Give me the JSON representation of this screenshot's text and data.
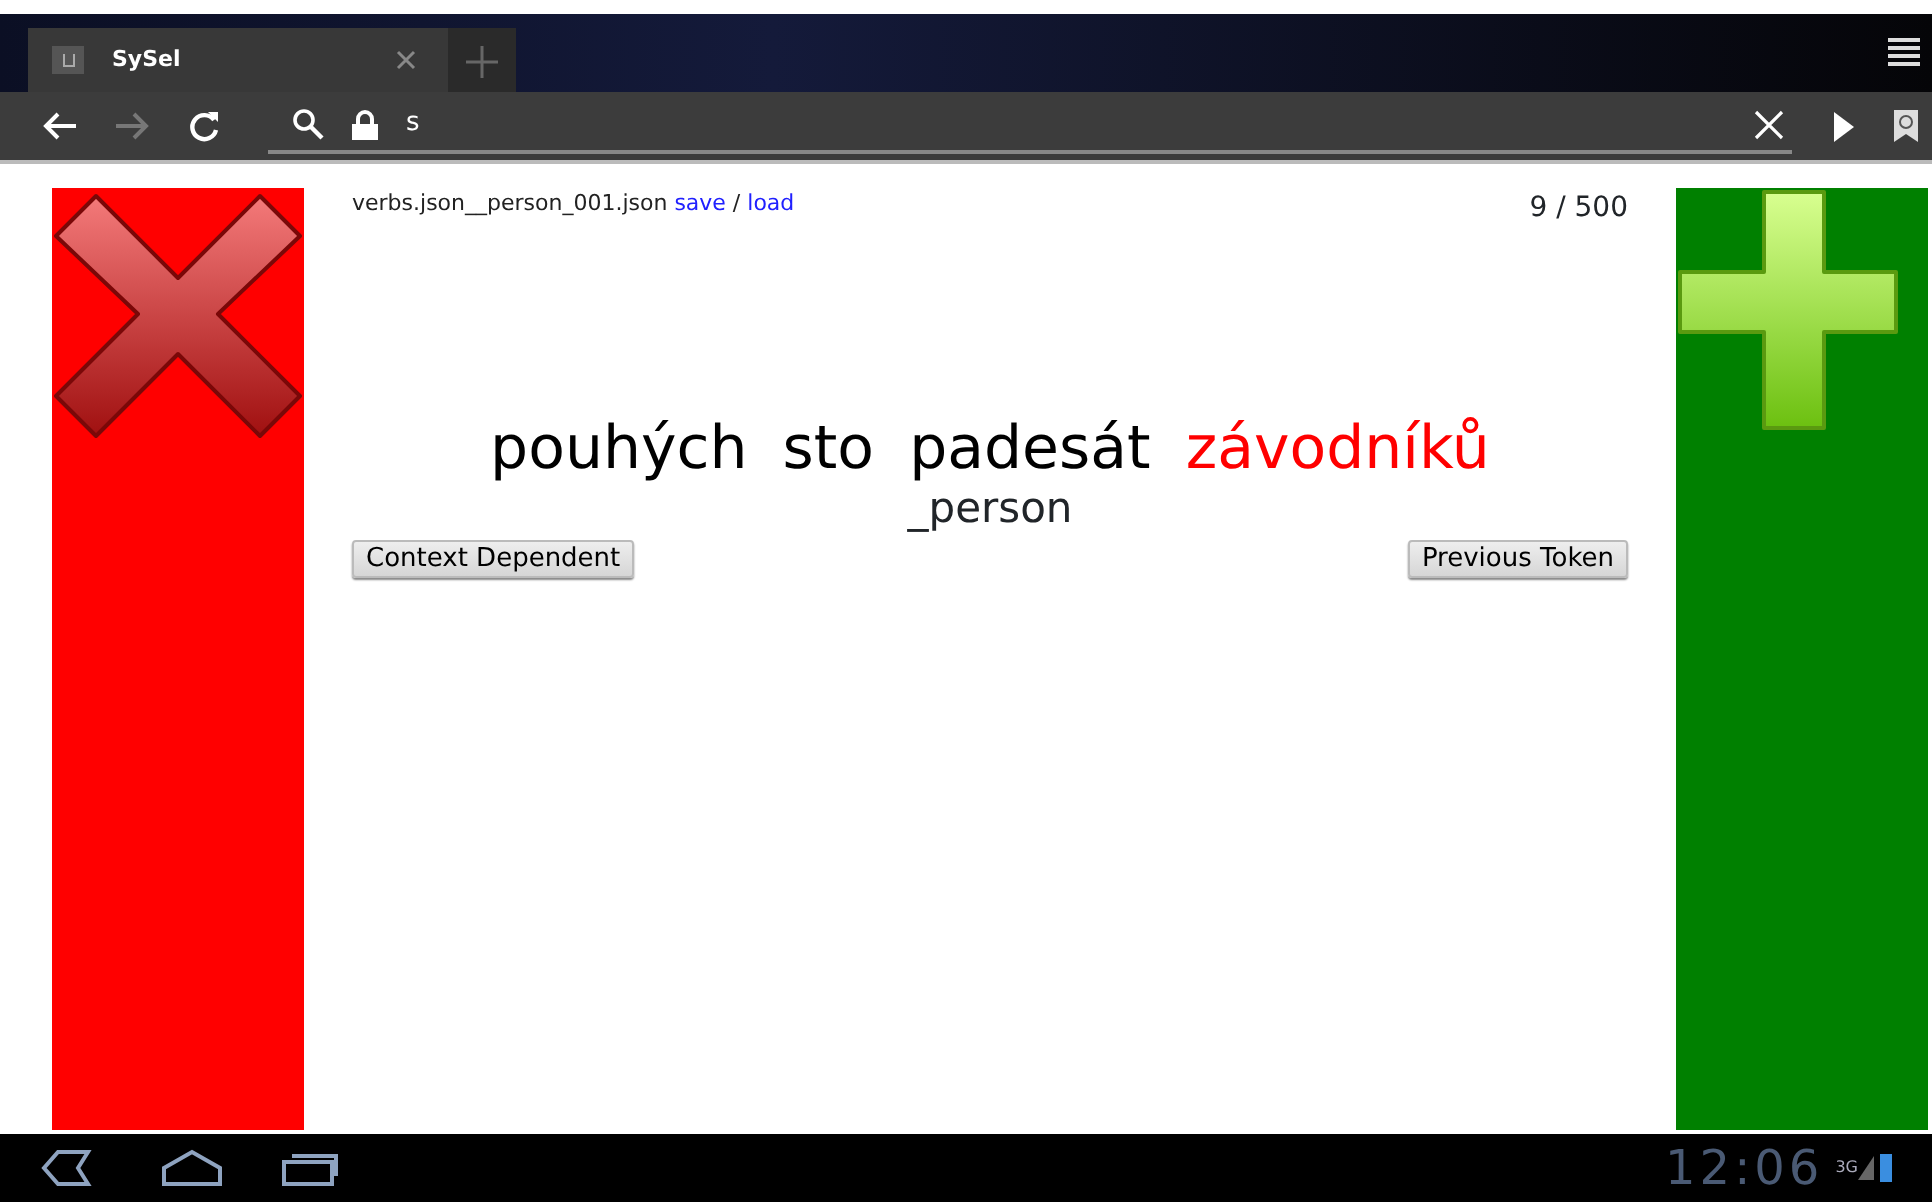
{
  "browser": {
    "tab": {
      "title": "SySel",
      "selected": true
    },
    "address": "s"
  },
  "page": {
    "filename": "verbs.json__person_001.json",
    "links": [
      {
        "label": "save"
      },
      {
        "label": "load"
      }
    ],
    "separator": "/",
    "counter": "9 / 500",
    "sentence": [
      {
        "text": "pouhých",
        "highlighted": false
      },
      {
        "text": "sto",
        "highlighted": false
      },
      {
        "text": "padesát",
        "highlighted": false
      },
      {
        "text": "závodníků",
        "highlighted": true
      }
    ],
    "tag": "_person",
    "buttons": [
      {
        "label": "Context Dependent"
      },
      {
        "label": "Previous Token"
      }
    ]
  },
  "status_bar": {
    "time": "12:06",
    "network": "3G"
  }
}
